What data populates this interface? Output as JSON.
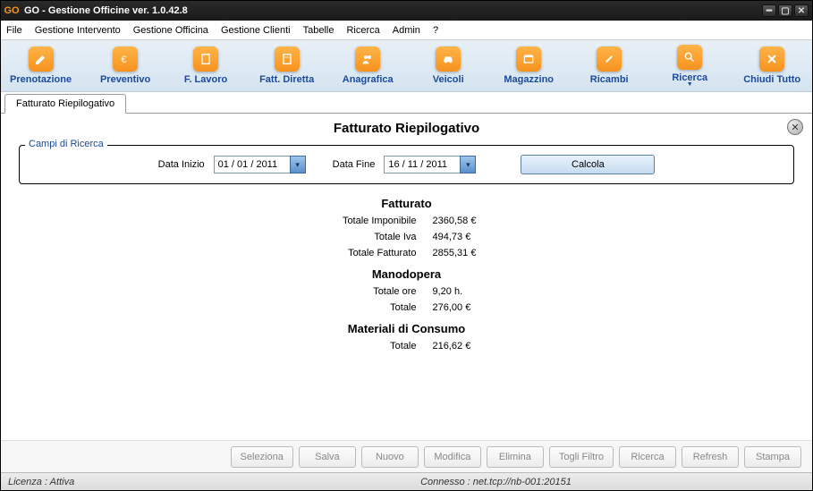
{
  "window": {
    "title": "GO - Gestione Officine ver. 1.0.42.8"
  },
  "menubar": {
    "items": [
      "File",
      "Gestione Intervento",
      "Gestione Officina",
      "Gestione Clienti",
      "Tabelle",
      "Ricerca",
      "Admin",
      "?"
    ]
  },
  "toolbar": {
    "items": [
      {
        "label": "Prenotazione",
        "icon": "pencil-icon"
      },
      {
        "label": "Preventivo",
        "icon": "euro-icon"
      },
      {
        "label": "F. Lavoro",
        "icon": "document-icon"
      },
      {
        "label": "Fatt. Diretta",
        "icon": "invoice-icon"
      },
      {
        "label": "Anagrafica",
        "icon": "people-icon"
      },
      {
        "label": "Veicoli",
        "icon": "car-icon"
      },
      {
        "label": "Magazzino",
        "icon": "box-icon"
      },
      {
        "label": "Ricambi",
        "icon": "parts-icon"
      },
      {
        "label": "Ricerca",
        "icon": "search-icon",
        "dropdown": true
      },
      {
        "label": "Chiudi Tutto",
        "icon": "close-icon"
      }
    ]
  },
  "tabs": {
    "active": "Fatturato Riepilogativo"
  },
  "page": {
    "title": "Fatturato Riepilogativo",
    "search_legend": "Campi di Ricerca",
    "data_inizio_label": "Data Inizio",
    "data_inizio_value": "01 / 01 / 2011",
    "data_fine_label": "Data Fine",
    "data_fine_value": "16 / 11 / 2011",
    "calcola_label": "Calcola",
    "sections": {
      "fatturato": {
        "heading": "Fatturato",
        "rows": [
          {
            "k": "Totale Imponibile",
            "v": "2360,58 €"
          },
          {
            "k": "Totale Iva",
            "v": "494,73 €"
          },
          {
            "k": "Totale Fatturato",
            "v": "2855,31 €"
          }
        ]
      },
      "manodopera": {
        "heading": "Manodopera",
        "rows": [
          {
            "k": "Totale ore",
            "v": "9,20 h."
          },
          {
            "k": "Totale",
            "v": "276,00 €"
          }
        ]
      },
      "materiali": {
        "heading": "Materiali di Consumo",
        "rows": [
          {
            "k": "Totale",
            "v": "216,62 €"
          }
        ]
      }
    }
  },
  "actions": {
    "buttons": [
      "Seleziona",
      "Salva",
      "Nuovo",
      "Modifica",
      "Elimina",
      "Togli Filtro",
      "Ricerca",
      "Refresh",
      "Stampa"
    ]
  },
  "status": {
    "license": "Licenza : Attiva",
    "connection": "Connesso : net.tcp://nb-001:20151"
  }
}
